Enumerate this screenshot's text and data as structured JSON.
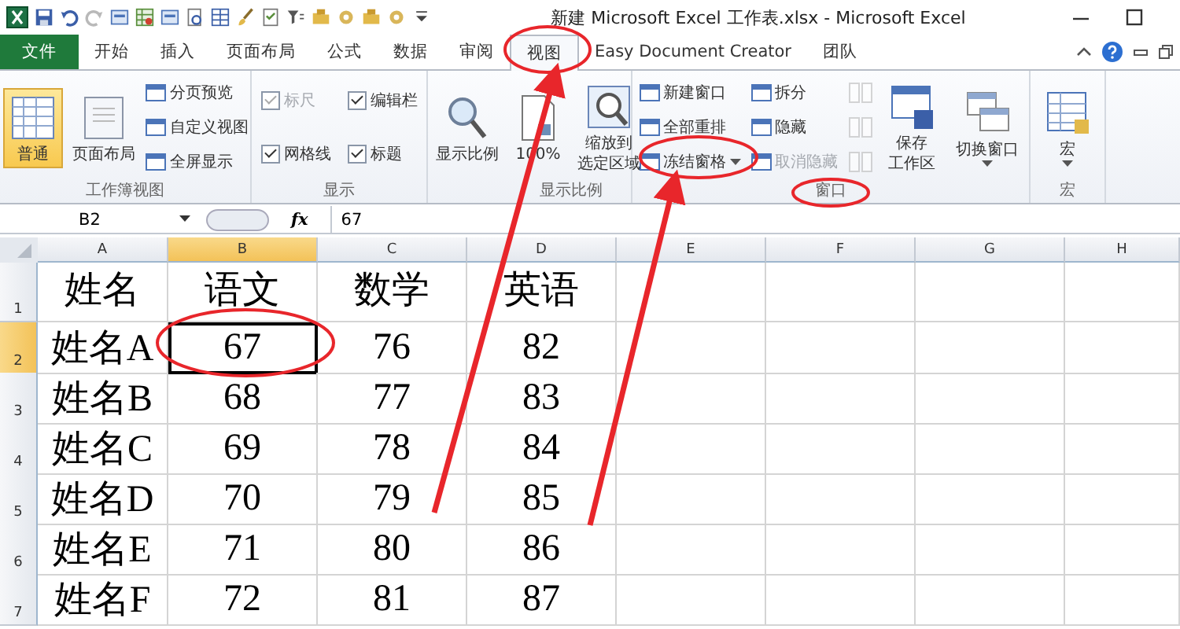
{
  "title_bar": {
    "title": "新建 Microsoft Excel 工作表.xlsx  -  Microsoft Excel"
  },
  "ribbon_tabs": [
    {
      "label": "文件",
      "kind": "file",
      "selected": false
    },
    {
      "label": "开始",
      "kind": "tab",
      "selected": false
    },
    {
      "label": "插入",
      "kind": "tab",
      "selected": false
    },
    {
      "label": "页面布局",
      "kind": "tab",
      "selected": false
    },
    {
      "label": "公式",
      "kind": "tab",
      "selected": false
    },
    {
      "label": "数据",
      "kind": "tab",
      "selected": false
    },
    {
      "label": "审阅",
      "kind": "tab",
      "selected": false
    },
    {
      "label": "视图",
      "kind": "tab",
      "selected": true
    },
    {
      "label": "Easy Document Creator",
      "kind": "tab",
      "selected": false
    },
    {
      "label": "团队",
      "kind": "tab",
      "selected": false
    }
  ],
  "ribbon_groups": [
    {
      "label": "工作簿视图",
      "columns": [
        [
          {
            "kind": "large",
            "lines": [
              "普通"
            ],
            "selected": true
          }
        ],
        [
          {
            "kind": "large",
            "lines": [
              "页面布局"
            ],
            "selected": false
          }
        ],
        [
          {
            "kind": "small",
            "label": "分页预览"
          },
          {
            "kind": "small",
            "label": "自定义视图"
          },
          {
            "kind": "small",
            "label": "全屏显示"
          }
        ]
      ]
    },
    {
      "label": "显示",
      "columns": [
        [
          {
            "kind": "checkbox",
            "label": "标尺",
            "checked": true,
            "disabled": true
          },
          {
            "kind": "checkbox",
            "label": "网格线",
            "checked": true,
            "disabled": false
          }
        ],
        [
          {
            "kind": "checkbox",
            "label": "编辑栏",
            "checked": true,
            "disabled": false
          },
          {
            "kind": "checkbox",
            "label": "标题",
            "checked": true,
            "disabled": false
          }
        ]
      ]
    },
    {
      "label": "显示比例",
      "columns": [
        [
          {
            "kind": "large",
            "lines": [
              "显示比例"
            ],
            "selected": false
          }
        ],
        [
          {
            "kind": "large",
            "lines": [
              "100%"
            ],
            "selected": false
          }
        ],
        [
          {
            "kind": "large",
            "lines": [
              "缩放到",
              "选定区域"
            ],
            "selected": false
          }
        ]
      ]
    },
    {
      "label": "窗口",
      "columns": [
        [
          {
            "kind": "small",
            "label": "新建窗口"
          },
          {
            "kind": "small",
            "label": "全部重排"
          },
          {
            "kind": "small",
            "label": "冻结窗格",
            "dropdown": true
          }
        ],
        [
          {
            "kind": "small",
            "label": "拆分"
          },
          {
            "kind": "small",
            "label": "隐藏"
          },
          {
            "kind": "small",
            "label": "取消隐藏",
            "disabled": true
          }
        ],
        [
          {
            "kind": "icon",
            "disabled": true
          },
          {
            "kind": "icon",
            "disabled": true
          },
          {
            "kind": "icon",
            "disabled": true
          }
        ],
        [
          {
            "kind": "large",
            "lines": [
              "保存",
              "工作区"
            ],
            "selected": false
          }
        ],
        [
          {
            "kind": "large",
            "lines": [
              "切换窗口"
            ],
            "selected": false,
            "dropdown": true
          }
        ]
      ]
    },
    {
      "label": "宏",
      "columns": [
        [
          {
            "kind": "large",
            "lines": [
              "宏"
            ],
            "selected": false,
            "dropdown": true
          }
        ]
      ]
    }
  ],
  "formula_bar": {
    "name_box": "B2",
    "function_label": "fx",
    "value": "67"
  },
  "sheet": {
    "columns": [
      {
        "label": "A",
        "selected": false
      },
      {
        "label": "B",
        "selected": true
      },
      {
        "label": "C",
        "selected": false
      },
      {
        "label": "D",
        "selected": false
      },
      {
        "label": "E",
        "selected": false
      },
      {
        "label": "F",
        "selected": false
      },
      {
        "label": "G",
        "selected": false
      },
      {
        "label": "H",
        "selected": false
      }
    ],
    "rows": [
      {
        "header": "1",
        "selected": false,
        "cells": [
          {
            "text": "姓名",
            "active": false
          },
          {
            "text": "语文",
            "active": false
          },
          {
            "text": "数学",
            "active": false
          },
          {
            "text": "英语",
            "active": false
          }
        ]
      },
      {
        "header": "2",
        "selected": true,
        "cells": [
          {
            "text": "姓名A",
            "active": false
          },
          {
            "text": "67",
            "active": true
          },
          {
            "text": "76",
            "active": false
          },
          {
            "text": "82",
            "active": false
          }
        ]
      },
      {
        "header": "3",
        "selected": false,
        "cells": [
          {
            "text": "姓名B",
            "active": false
          },
          {
            "text": "68",
            "active": false
          },
          {
            "text": "77",
            "active": false
          },
          {
            "text": "83",
            "active": false
          }
        ]
      },
      {
        "header": "4",
        "selected": false,
        "cells": [
          {
            "text": "姓名C",
            "active": false
          },
          {
            "text": "69",
            "active": false
          },
          {
            "text": "78",
            "active": false
          },
          {
            "text": "84",
            "active": false
          }
        ]
      },
      {
        "header": "5",
        "selected": false,
        "cells": [
          {
            "text": "姓名D",
            "active": false
          },
          {
            "text": "70",
            "active": false
          },
          {
            "text": "79",
            "active": false
          },
          {
            "text": "85",
            "active": false
          }
        ]
      },
      {
        "header": "6",
        "selected": false,
        "cells": [
          {
            "text": "姓名E",
            "active": false
          },
          {
            "text": "71",
            "active": false
          },
          {
            "text": "80",
            "active": false
          },
          {
            "text": "86",
            "active": false
          }
        ]
      },
      {
        "header": "7",
        "selected": false,
        "cells": [
          {
            "text": "姓名F",
            "active": false
          },
          {
            "text": "72",
            "active": false
          },
          {
            "text": "81",
            "active": false
          },
          {
            "text": "87",
            "active": false
          }
        ]
      }
    ]
  },
  "annotations": [
    {
      "kind": "ellipse"
    },
    {
      "kind": "ellipse"
    },
    {
      "kind": "ellipse"
    },
    {
      "kind": "ellipse"
    },
    {
      "kind": "arrow"
    },
    {
      "kind": "arrow"
    }
  ]
}
